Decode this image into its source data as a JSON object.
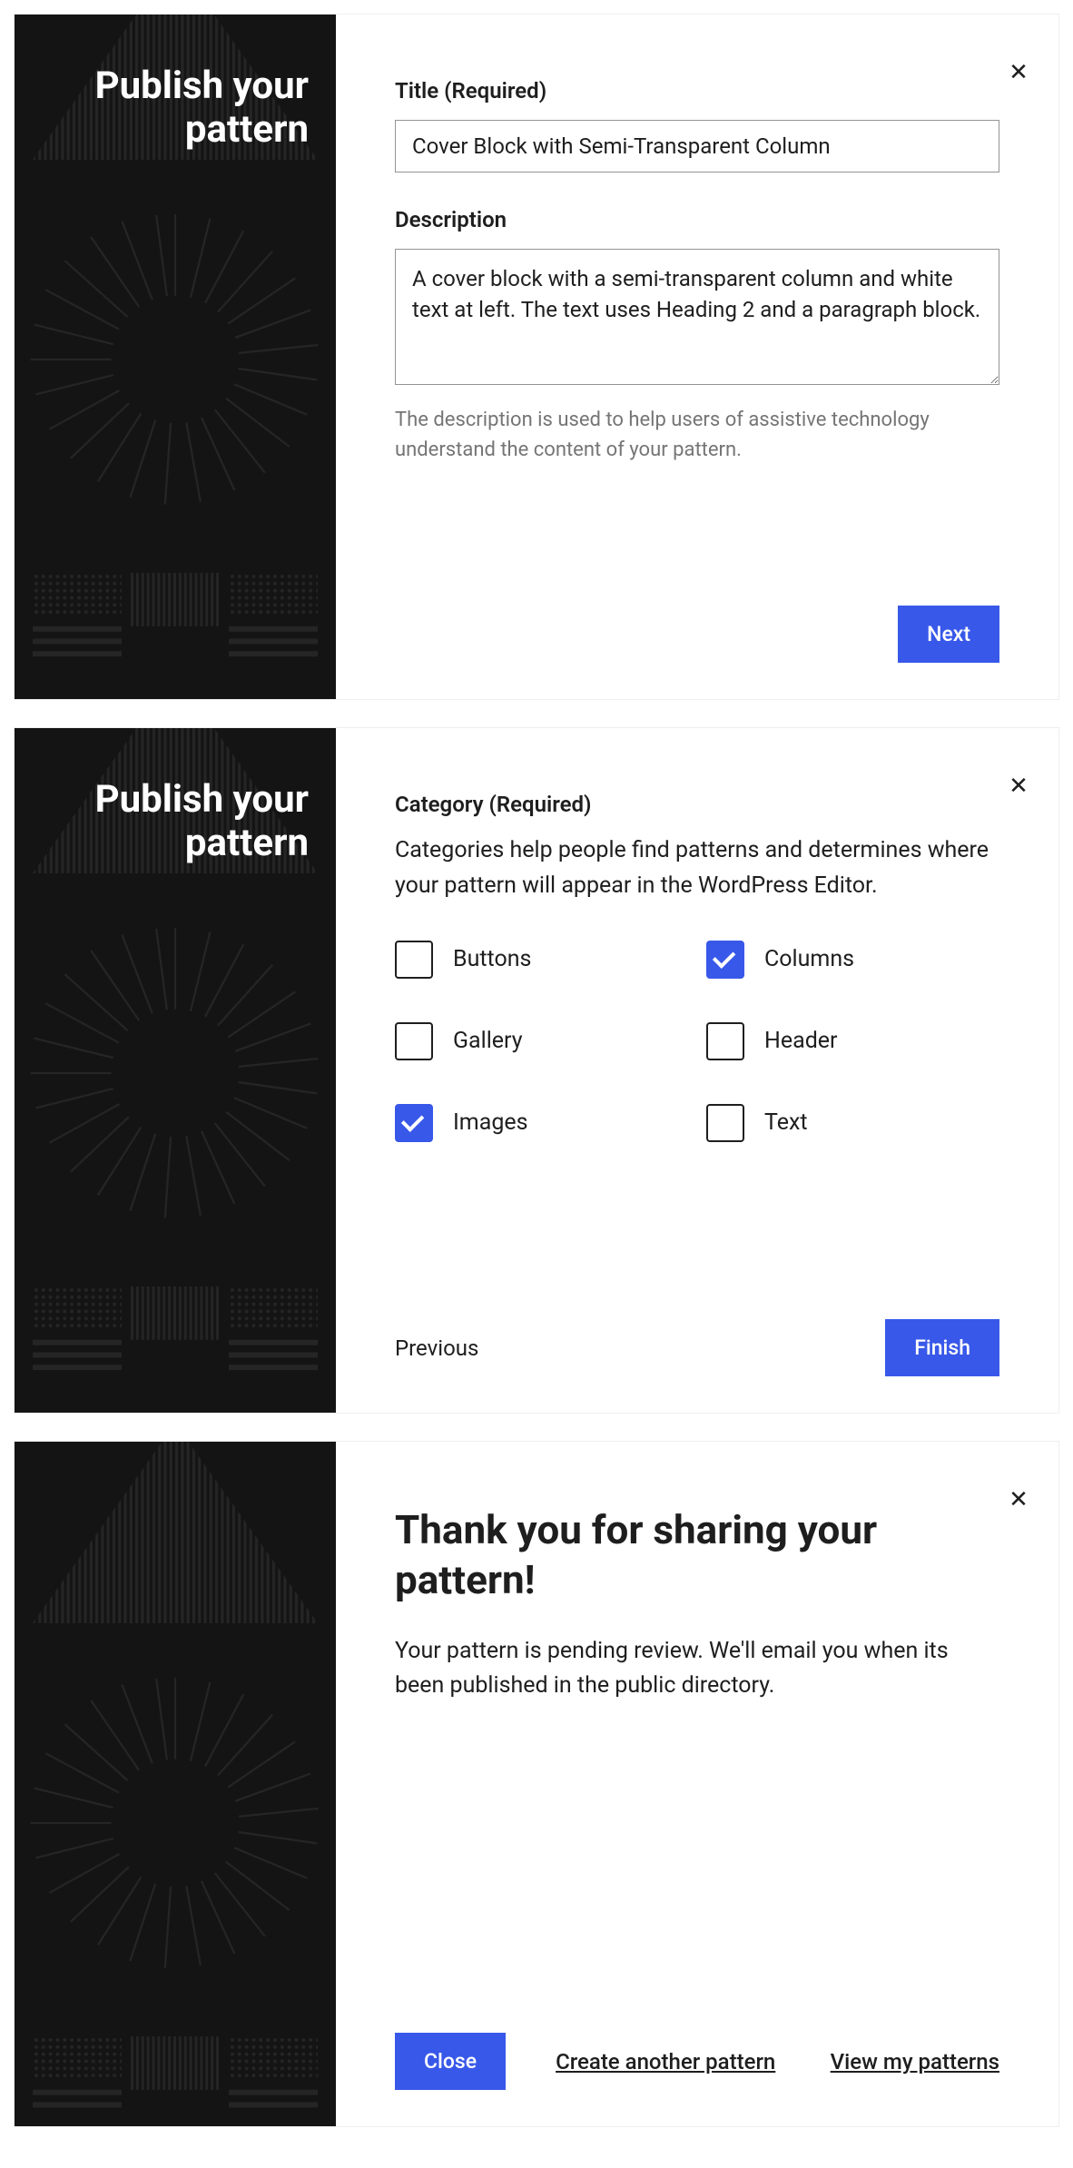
{
  "step1": {
    "sidebar_title": "Publish your pattern",
    "title_label": "Title (Required)",
    "title_value": "Cover Block with Semi-Transparent Column",
    "description_label": "Description",
    "description_value": "A cover block with a semi-transparent column and white text at left. The text uses Heading 2 and a paragraph block.",
    "description_helper": "The description is used to help users of assistive technology understand the content of your pattern.",
    "next_button": "Next"
  },
  "step2": {
    "sidebar_title": "Publish your pattern",
    "category_label": "Category (Required)",
    "category_helper": "Categories help people find patterns and determines where your pattern will appear in the WordPress Editor.",
    "categories": [
      {
        "label": "Buttons",
        "checked": false
      },
      {
        "label": "Columns",
        "checked": true
      },
      {
        "label": "Gallery",
        "checked": false
      },
      {
        "label": "Header",
        "checked": false
      },
      {
        "label": "Images",
        "checked": true
      },
      {
        "label": "Text",
        "checked": false
      }
    ],
    "previous_button": "Previous",
    "finish_button": "Finish"
  },
  "step3": {
    "thank_title": "Thank you for sharing your pattern!",
    "thank_body": "Your pattern is pending review. We'll email you when its been published in the public directory.",
    "close_button": "Close",
    "create_another": "Create another pattern",
    "view_patterns": "View my patterns"
  },
  "colors": {
    "primary": "#3858e9",
    "sidebar_bg": "#141414"
  }
}
